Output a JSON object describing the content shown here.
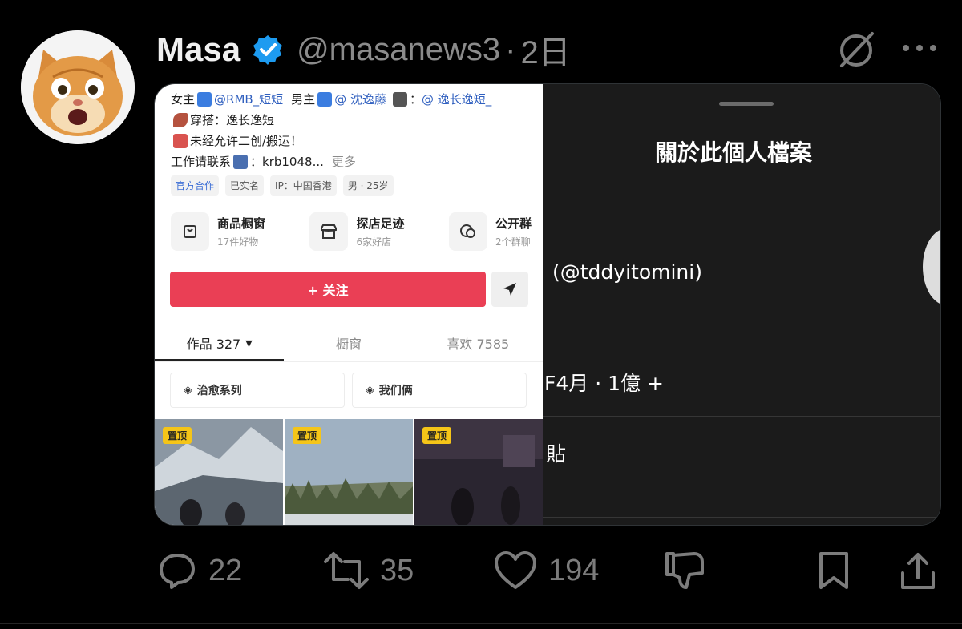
{
  "post": {
    "author_name": "Masa",
    "handle": "@masanews3",
    "separator": "·",
    "time": "2日",
    "avatar_icon": "cat-avatar-icon"
  },
  "left_screenshot": {
    "bio": {
      "line1": {
        "a": "女主",
        "b": "@RMB_短短",
        "c": "男主",
        "d": "@ 沈逸藤",
        "e": "：",
        "f": "@ 逸长逸短_"
      },
      "line2": "穿搭：逸长逸短",
      "line3": "未经允许二创/搬运！",
      "line4_text": "工作请联系",
      "line4_value": "：krb1048...",
      "line4_more": "更多"
    },
    "tags": [
      "官方合作",
      "已实名",
      "IP：中国香港",
      "男 · 25岁"
    ],
    "services": [
      {
        "title": "商品橱窗",
        "sub": "17件好物",
        "icon": "shop-window-icon"
      },
      {
        "title": "探店足迹",
        "sub": "6家好店",
        "icon": "store-icon"
      },
      {
        "title": "公开群",
        "sub": "2个群聊",
        "icon": "chat-group-icon"
      }
    ],
    "follow_label": "+ 关注",
    "tabs": {
      "works": "作品 327",
      "window": "橱窗",
      "likes": "喜欢 7585"
    },
    "collections": [
      "治愈系列",
      "我们俩"
    ],
    "pin_label": "置顶"
  },
  "right_screenshot": {
    "title": "關於此個人檔案",
    "handle": "(@tddyitomini)",
    "date": "F4月 · 1億 +",
    "link": "貼"
  },
  "actions": {
    "replies": "22",
    "reposts": "35",
    "likes": "194"
  },
  "colors": {
    "background": "#000000",
    "verified": "#1d9bf0",
    "follow": "#ea3f55",
    "muted": "#7c7c7c"
  }
}
